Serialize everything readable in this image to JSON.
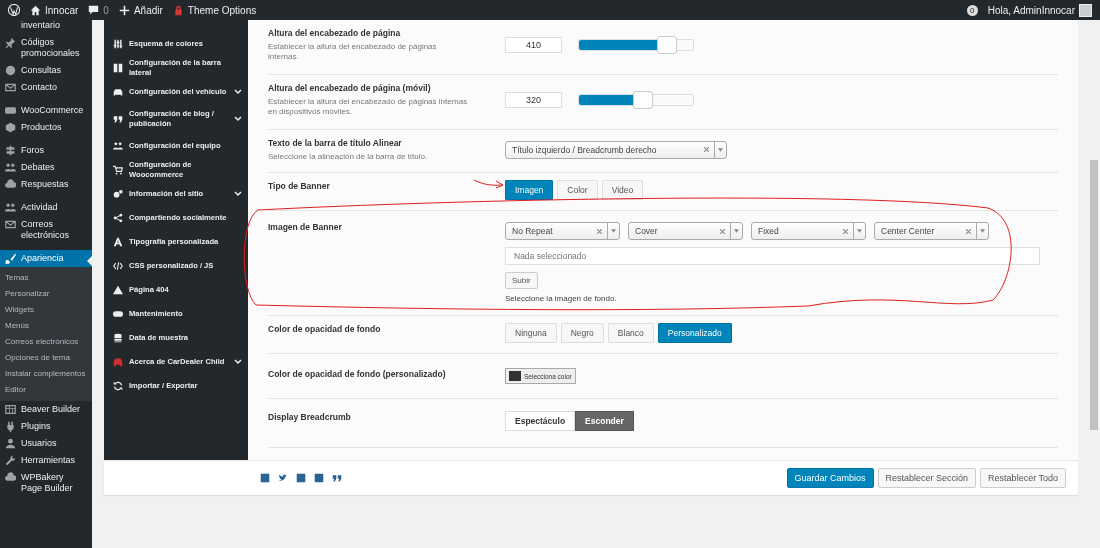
{
  "admin_bar": {
    "site_name": "Innocar",
    "comments": "0",
    "new_label": "Añadir",
    "theme_options": "Theme Options",
    "notifications": "0",
    "greeting": "Hola, AdminInnocar"
  },
  "wp_menu": [
    {
      "label": "inventario",
      "selected": false
    },
    {
      "label": "Códigos promocionales",
      "selected": false
    },
    {
      "label": "Consultas",
      "selected": false
    },
    {
      "label": "Contacto",
      "selected": false
    },
    {
      "label": "WooCommerce",
      "selected": false
    },
    {
      "label": "Productos",
      "selected": false
    },
    {
      "label": "Foros",
      "selected": false
    },
    {
      "label": "Debates",
      "selected": false
    },
    {
      "label": "Respuestas",
      "selected": false
    },
    {
      "label": "Actividad",
      "selected": false
    },
    {
      "label": "Correos electrónicos",
      "selected": false
    },
    {
      "label": "Apariencia",
      "selected": true,
      "submenu": [
        "Temas",
        "Personalizar",
        "Widgets",
        "Menús",
        "Correos electrónicos",
        "Opciones de tema",
        "Instalar complementos",
        "Editor"
      ]
    },
    {
      "label": "Beaver Builder",
      "selected": false
    },
    {
      "label": "Plugins",
      "selected": false
    },
    {
      "label": "Usuarios",
      "selected": false
    },
    {
      "label": "Herramientas",
      "selected": false
    },
    {
      "label": "WPBakery Page Builder",
      "selected": false
    }
  ],
  "theme_nav": [
    {
      "label": "Esquema de colores",
      "has_submenu": false
    },
    {
      "label": "Configuración de la barra lateral",
      "has_submenu": false
    },
    {
      "label": "Configuración del vehículo",
      "has_submenu": true
    },
    {
      "label": "Configuración de blog / publicación",
      "has_submenu": true
    },
    {
      "label": "Configuración del equipo",
      "has_submenu": false
    },
    {
      "label": "Configuración de Woocommerce",
      "has_submenu": false
    },
    {
      "label": "Información del sitio",
      "has_submenu": true
    },
    {
      "label": "Compartiendo socialmente",
      "has_submenu": false
    },
    {
      "label": "Tipografía personalizada",
      "has_submenu": false
    },
    {
      "label": "CSS personalizado / JS",
      "has_submenu": false
    },
    {
      "label": "Página 404",
      "has_submenu": false
    },
    {
      "label": "Mantenimiento",
      "has_submenu": false
    },
    {
      "label": "Data de muestra",
      "has_submenu": false
    },
    {
      "label": "Acerca de CarDealer Child",
      "has_submenu": true
    },
    {
      "label": "Importar / Exportar",
      "has_submenu": false
    }
  ],
  "options": [
    {
      "kind": "slider",
      "title": "Altura del encabezado de página",
      "description": "Establecer la altura del encabezado de páginas internas.",
      "value": "410",
      "level": 0.76
    },
    {
      "kind": "slider",
      "title": "Altura del encabezado de página (móvil)",
      "description": "Establecer la altura del encabezado de páginas internas en dispositivos móviles.",
      "value": "320",
      "level": 0.55
    },
    {
      "kind": "select",
      "title": "Texto de la barra de título Alinear",
      "description": "Seleccione la alineación de la barra de título.",
      "value": "Título izquierdo / Breadcrumb derecho"
    },
    {
      "kind": "buttonset",
      "title": "Tipo de Banner",
      "choices": [
        {
          "label": "Imagen",
          "selected": true
        },
        {
          "label": "Color",
          "selected": false
        },
        {
          "label": "Video",
          "selected": false
        }
      ]
    },
    {
      "kind": "media",
      "title": "Imagen de Banner",
      "selects": [
        "No Repeat",
        "Cover",
        "Fixed",
        "Center Center"
      ],
      "placeholder": "Nada seleccionado",
      "upload_label": "Subir",
      "hint": "Seleccione la imagen de fondo."
    },
    {
      "kind": "buttonset",
      "title": "Color de opacidad de fondo",
      "choices": [
        {
          "label": "Ninguna",
          "selected": false
        },
        {
          "label": "Negro",
          "selected": false
        },
        {
          "label": "Blanco",
          "selected": false
        },
        {
          "label": "Personalizado",
          "selected": true
        }
      ]
    },
    {
      "kind": "color",
      "title": "Color de opacidad de fondo (personalizado)",
      "button_label": "Selecciona color",
      "color": "#333333"
    },
    {
      "kind": "switch",
      "title": "Display Breadcrumb",
      "choices": [
        {
          "label": "Espectáculo",
          "selected": false
        },
        {
          "label": "Esconder",
          "selected": true
        }
      ]
    }
  ],
  "footer": {
    "buttons": [
      {
        "label": "Guardar Cambios",
        "primary": true
      },
      {
        "label": "Restablecer Sección",
        "primary": false
      },
      {
        "label": "Restablecer Todo",
        "primary": false
      }
    ]
  }
}
